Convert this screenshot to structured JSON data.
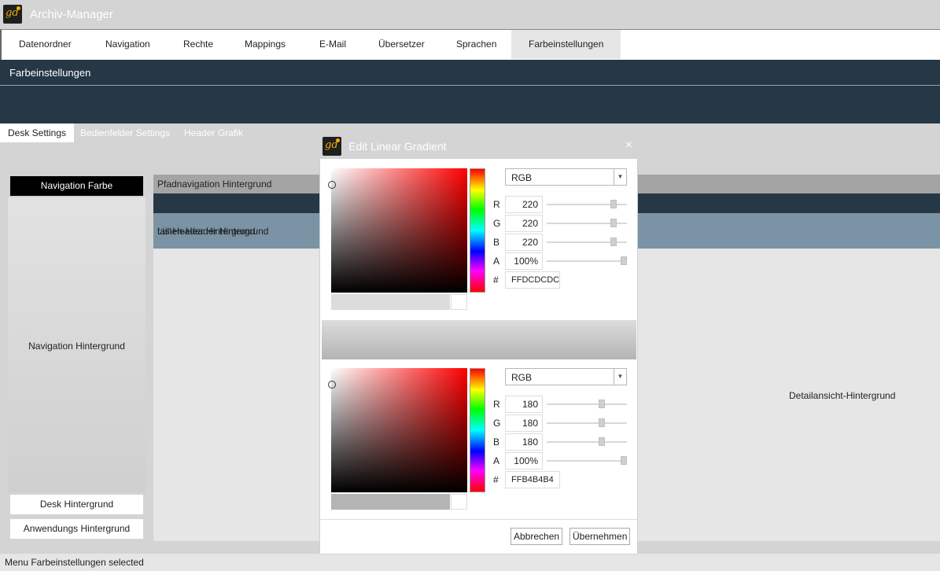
{
  "app": {
    "title": "Archiv-Manager",
    "logo_text": "gd"
  },
  "menu": {
    "items": [
      {
        "label": "Datenordner"
      },
      {
        "label": "Navigation"
      },
      {
        "label": "Rechte"
      },
      {
        "label": "Mappings"
      },
      {
        "label": "E-Mail"
      },
      {
        "label": "Übersetzer"
      },
      {
        "label": "Sprachen"
      },
      {
        "label": "Farbeinstellungen",
        "active": true
      }
    ]
  },
  "section": {
    "title": "Farbeinstellungen"
  },
  "subtabs": [
    {
      "label": "Desk Settings",
      "active": true
    },
    {
      "label": "Bedienfelder Settings"
    },
    {
      "label": "Header Grafik"
    }
  ],
  "left_panel": {
    "nav_farbe": "Navigation Farbe",
    "nav_hintergrund": "Navigation Hintergrund",
    "desk_hintergrund": "Desk Hintergrund",
    "anwendungs_hintergrund": "Anwendungs Hintergrund"
  },
  "preview": {
    "pfad": "Pfadnavigation Hintergrund",
    "listen_header": "Listen-Header Hintergrund",
    "detail_header": "tail-Header Hintergrund",
    "detail_bg": "Detailansicht-Hintergrund"
  },
  "dialog": {
    "title": "Edit Linear Gradient",
    "close_glyph": "×",
    "cancel_label": "Abbrechen",
    "apply_label": "Übernehmen",
    "stop1": {
      "mode": "RGB",
      "r": "220",
      "g": "220",
      "b": "220",
      "a": "100%",
      "hex": "FFDCDCDC",
      "labels": {
        "r": "R",
        "g": "G",
        "b": "B",
        "a": "A",
        "hex": "#"
      },
      "slider_fractions": {
        "r": 0.8627,
        "g": 0.8627,
        "b": 0.8627,
        "a": 1.0
      },
      "color": "#dcdcdc"
    },
    "stop2": {
      "mode": "RGB",
      "r": "180",
      "g": "180",
      "b": "180",
      "a": "100%",
      "hex": "FFB4B4B4",
      "labels": {
        "r": "R",
        "g": "G",
        "b": "B",
        "a": "A",
        "hex": "#"
      },
      "slider_fractions": {
        "r": 0.7059,
        "g": 0.7059,
        "b": 0.7059,
        "a": 1.0
      },
      "color": "#b4b4b4"
    }
  },
  "status": {
    "text": "Menu Farbeinstellungen selected"
  },
  "colors": {
    "header_dark": "#263746",
    "listen_header": "#7a93a5",
    "logo_accent": "#f0b000"
  }
}
